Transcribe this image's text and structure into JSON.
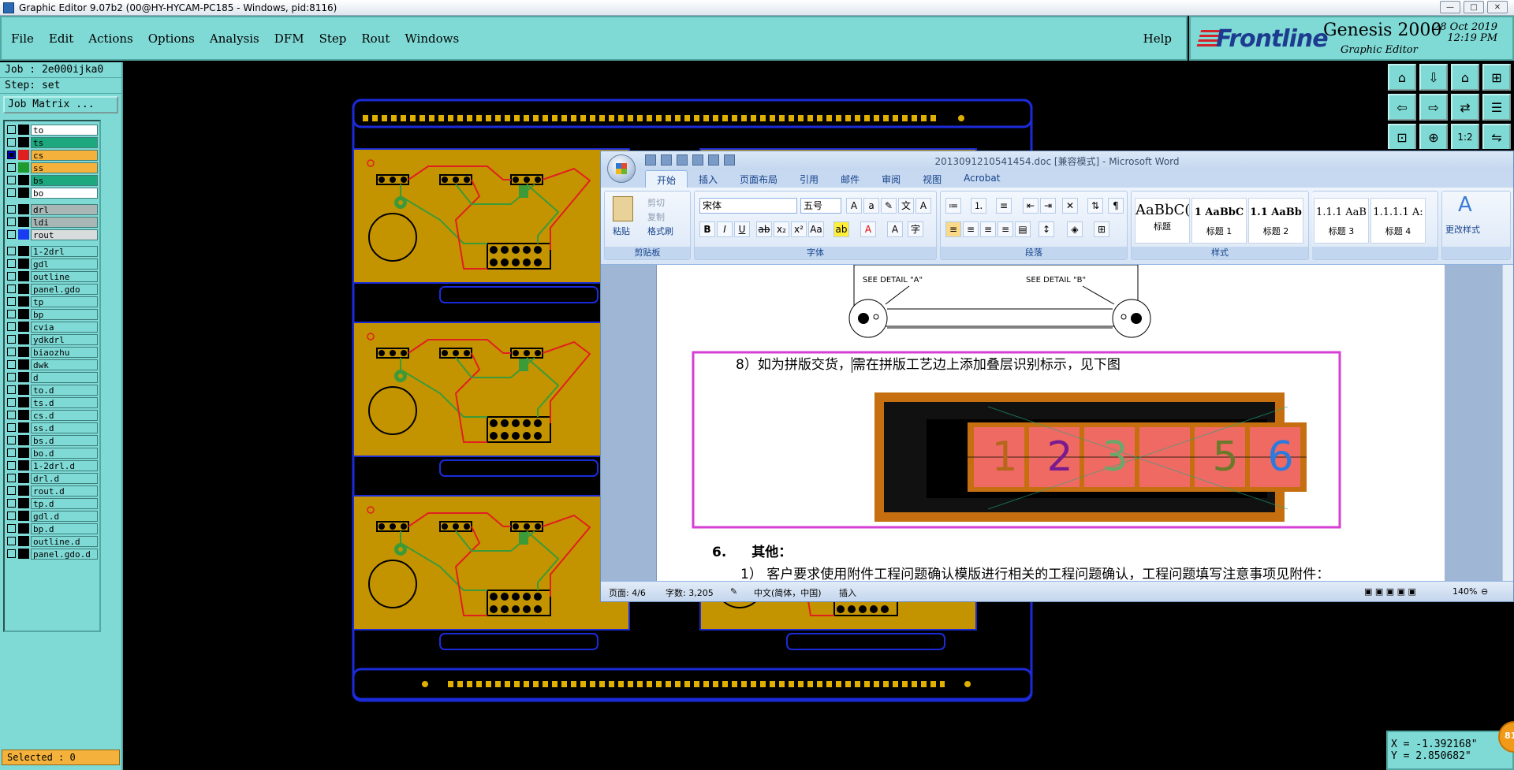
{
  "titlebar": {
    "title": "Graphic Editor 9.07b2 (00@HY-HYCAM-PC185 - Windows, pid:8116)"
  },
  "menubar": {
    "items": [
      "File",
      "Edit",
      "Actions",
      "Options",
      "Analysis",
      "DFM",
      "Step",
      "Rout",
      "Windows"
    ],
    "help": "Help"
  },
  "brand": {
    "logo": "Frontline",
    "product": "Genesis 2000",
    "subtitle": "Graphic Editor",
    "date": "28 Oct 2019",
    "time": "12:19 PM"
  },
  "panel": {
    "job": "Job : 2e000ijka0",
    "step": "Step: set",
    "job_matrix": "Job Matrix ...",
    "selected": "Selected : 0"
  },
  "layers": [
    {
      "name": "to",
      "color": "#ffffff",
      "swatch": "#000000",
      "checked": false
    },
    {
      "name": "ts",
      "color": "#1ea87e",
      "swatch": "#000000",
      "checked": false
    },
    {
      "name": "cs",
      "color": "#f4b23c",
      "swatch": "#e02020",
      "checked": true,
      "marker": "#0000cc"
    },
    {
      "name": "ss",
      "color": "#f4b23c",
      "swatch": "#1f9a2e",
      "checked": false
    },
    {
      "name": "bs",
      "color": "#1ea87e",
      "swatch": "#000000",
      "checked": false
    },
    {
      "name": "bo",
      "color": "#ffffff",
      "swatch": "#000000",
      "checked": false
    },
    {
      "gap": true
    },
    {
      "name": "drl",
      "color": "#a8b7b6",
      "swatch": "#000000",
      "checked": false
    },
    {
      "name": "ldi",
      "color": "#a8b7b6",
      "swatch": "#000000",
      "checked": false
    },
    {
      "name": "rout",
      "color": "#d8dcdc",
      "swatch": "#1a3cf0",
      "checked": false
    },
    {
      "gap": true
    },
    {
      "name": "1-2drl",
      "color": "#7fd9d5",
      "swatch": "#000000",
      "checked": false
    },
    {
      "name": "gdl",
      "color": "#7fd9d5",
      "swatch": "#000000",
      "checked": false
    },
    {
      "name": "outline",
      "color": "#7fd9d5",
      "swatch": "#000000",
      "checked": false
    },
    {
      "name": "panel.gdo",
      "color": "#7fd9d5",
      "swatch": "#000000",
      "checked": false
    },
    {
      "name": "tp",
      "color": "#7fd9d5",
      "swatch": "#000000",
      "checked": false
    },
    {
      "name": "bp",
      "color": "#7fd9d5",
      "swatch": "#000000",
      "checked": false
    },
    {
      "name": "cvia",
      "color": "#7fd9d5",
      "swatch": "#000000",
      "checked": false
    },
    {
      "name": "ydkdrl",
      "color": "#7fd9d5",
      "swatch": "#000000",
      "checked": false
    },
    {
      "name": "biaozhu",
      "color": "#7fd9d5",
      "swatch": "#000000",
      "checked": false
    },
    {
      "name": "dwk",
      "color": "#7fd9d5",
      "swatch": "#000000",
      "checked": false
    },
    {
      "name": "d",
      "color": "#7fd9d5",
      "swatch": "#000000",
      "checked": false
    },
    {
      "name": "to.d",
      "color": "#7fd9d5",
      "swatch": "#000000",
      "checked": false
    },
    {
      "name": "ts.d",
      "color": "#7fd9d5",
      "swatch": "#000000",
      "checked": false
    },
    {
      "name": "cs.d",
      "color": "#7fd9d5",
      "swatch": "#000000",
      "checked": false
    },
    {
      "name": "ss.d",
      "color": "#7fd9d5",
      "swatch": "#000000",
      "checked": false
    },
    {
      "name": "bs.d",
      "color": "#7fd9d5",
      "swatch": "#000000",
      "checked": false
    },
    {
      "name": "bo.d",
      "color": "#7fd9d5",
      "swatch": "#000000",
      "checked": false
    },
    {
      "name": "1-2drl.d",
      "color": "#7fd9d5",
      "swatch": "#000000",
      "checked": false
    },
    {
      "name": "drl.d",
      "color": "#7fd9d5",
      "swatch": "#000000",
      "checked": false
    },
    {
      "name": "rout.d",
      "color": "#7fd9d5",
      "swatch": "#000000",
      "checked": false
    },
    {
      "name": "tp.d",
      "color": "#7fd9d5",
      "swatch": "#000000",
      "checked": false
    },
    {
      "name": "gdl.d",
      "color": "#7fd9d5",
      "swatch": "#000000",
      "checked": false
    },
    {
      "name": "bp.d",
      "color": "#7fd9d5",
      "swatch": "#000000",
      "checked": false
    },
    {
      "name": "outline.d",
      "color": "#7fd9d5",
      "swatch": "#000000",
      "checked": false
    },
    {
      "name": "panel.gdo.d",
      "color": "#7fd9d5",
      "swatch": "#000000",
      "checked": false
    }
  ],
  "coords": {
    "x": "X = -1.392168\"",
    "y": "Y = 2.850682\""
  },
  "bubble": "81",
  "word": {
    "title": "20130912105414​54.doc [兼容模式] - Microsoft Word",
    "tabs": [
      "开始",
      "插入",
      "页面布局",
      "引用",
      "邮件",
      "审阅",
      "视图",
      "Acrobat"
    ],
    "clipboard": {
      "paste": "粘贴",
      "cut": "剪切",
      "copy": "复制",
      "format_painter": "格式刷",
      "label": "剪贴板"
    },
    "font": {
      "name": "宋体",
      "size": "五号",
      "label": "字体"
    },
    "paragraph_label": "段落",
    "styles": {
      "label": "样式",
      "change": "更改样式",
      "items": [
        {
          "preview": "AaBbC(",
          "name": "标题"
        },
        {
          "preview": "1 AaBbC",
          "name": "标题 1"
        },
        {
          "preview": "1.1 AaBb",
          "name": "标题 2"
        },
        {
          "preview": "1.1.1 AaB",
          "name": "标题 3"
        },
        {
          "preview": "1.1.1.1 A:",
          "name": "标题 4"
        }
      ]
    },
    "doc": {
      "detail_a": "SEE DETAIL \"A\"",
      "detail_b": "SEE DETAIL \"B\"",
      "item8_a": "8）如为拼版交货，",
      "item8_b": "需在拼版工艺边上添加叠层识别标示，见下图",
      "stack_digits": [
        "1",
        "2",
        "3",
        "",
        "5",
        "6"
      ],
      "section6_num": "6.",
      "section6_title": "其他：",
      "item1": "1）  客户要求使用附件工程问题确认模版进行相关的工程问题确认，工程问题填写注意事项见附件："
    },
    "status": {
      "page": "页面: 4/6",
      "words": "字数: 3,205",
      "lang": "中文(简体，中国)",
      "mode": "插入",
      "zoom": "140%"
    }
  }
}
